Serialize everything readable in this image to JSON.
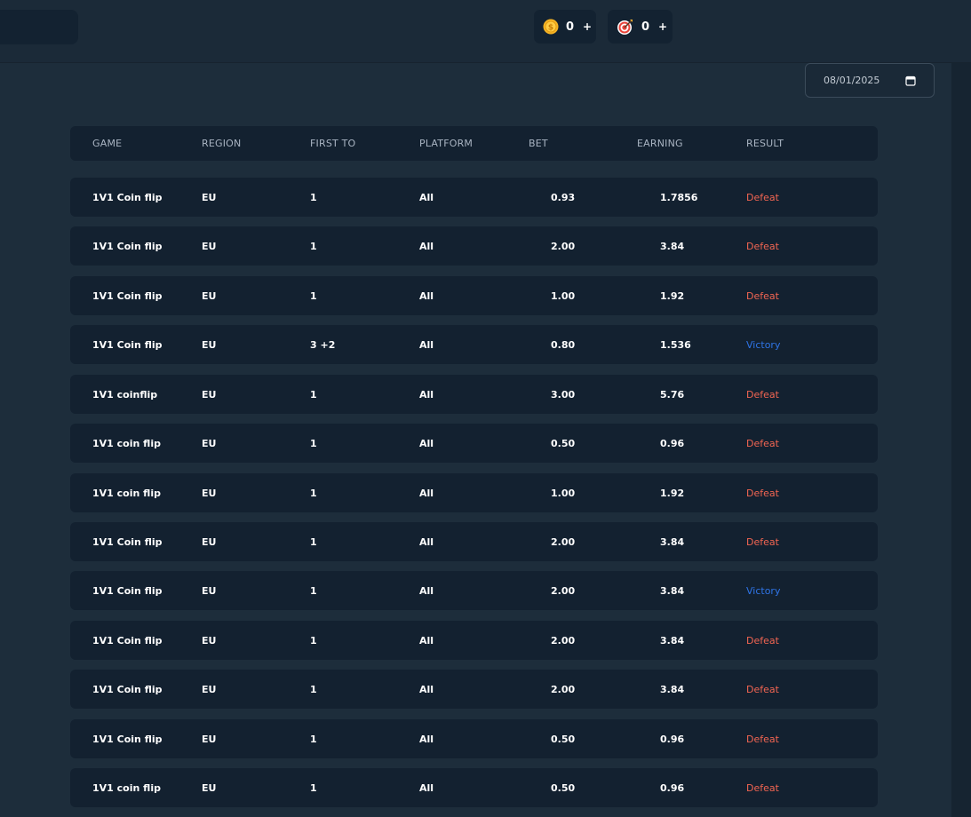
{
  "topbar": {
    "coins": {
      "value": "0",
      "plus": "+",
      "icon": "coin-icon"
    },
    "targets": {
      "value": "0",
      "plus": "+",
      "icon": "target-icon"
    }
  },
  "date_filter": {
    "value": "08/01/2025",
    "icon": "calendar-icon"
  },
  "table": {
    "headers": {
      "game": "GAME",
      "region": "REGION",
      "first_to": "FIRST TO",
      "platform": "PLATFORM",
      "bet": "BET",
      "earning": "EARNING",
      "result": "RESULT"
    },
    "rows": [
      {
        "game": "1V1 Coin flip",
        "region": "EU",
        "first_to": "1",
        "platform": "All",
        "bet": "0.93",
        "earning": "1.7856",
        "result": "Defeat"
      },
      {
        "game": "1V1 Coin flip",
        "region": "EU",
        "first_to": "1",
        "platform": "All",
        "bet": "2.00",
        "earning": "3.84",
        "result": "Defeat"
      },
      {
        "game": "1V1 Coin flip",
        "region": "EU",
        "first_to": "1",
        "platform": "All",
        "bet": "1.00",
        "earning": "1.92",
        "result": "Defeat"
      },
      {
        "game": "1V1 Coin flip",
        "region": "EU",
        "first_to": "3 +2",
        "platform": "All",
        "bet": "0.80",
        "earning": "1.536",
        "result": "Victory"
      },
      {
        "game": "1V1 coinflip",
        "region": "EU",
        "first_to": "1",
        "platform": "All",
        "bet": "3.00",
        "earning": "5.76",
        "result": "Defeat"
      },
      {
        "game": "1V1 coin flip",
        "region": "EU",
        "first_to": "1",
        "platform": "All",
        "bet": "0.50",
        "earning": "0.96",
        "result": "Defeat"
      },
      {
        "game": "1V1 coin flip",
        "region": "EU",
        "first_to": "1",
        "platform": "All",
        "bet": "1.00",
        "earning": "1.92",
        "result": "Defeat"
      },
      {
        "game": "1V1 Coin flip",
        "region": "EU",
        "first_to": "1",
        "platform": "All",
        "bet": "2.00",
        "earning": "3.84",
        "result": "Defeat"
      },
      {
        "game": "1V1 Coin flip",
        "region": "EU",
        "first_to": "1",
        "platform": "All",
        "bet": "2.00",
        "earning": "3.84",
        "result": "Victory"
      },
      {
        "game": "1V1 Coin flip",
        "region": "EU",
        "first_to": "1",
        "platform": "All",
        "bet": "2.00",
        "earning": "3.84",
        "result": "Defeat"
      },
      {
        "game": "1V1 Coin flip",
        "region": "EU",
        "first_to": "1",
        "platform": "All",
        "bet": "2.00",
        "earning": "3.84",
        "result": "Defeat"
      },
      {
        "game": "1V1 Coin flip",
        "region": "EU",
        "first_to": "1",
        "platform": "All",
        "bet": "0.50",
        "earning": "0.96",
        "result": "Defeat"
      },
      {
        "game": "1V1 coin flip",
        "region": "EU",
        "first_to": "1",
        "platform": "All",
        "bet": "0.50",
        "earning": "0.96",
        "result": "Defeat"
      }
    ]
  },
  "colors": {
    "defeat": "#f26552",
    "victory": "#2f74e6",
    "background": "#1d2d3b",
    "row_background": "#132130"
  }
}
